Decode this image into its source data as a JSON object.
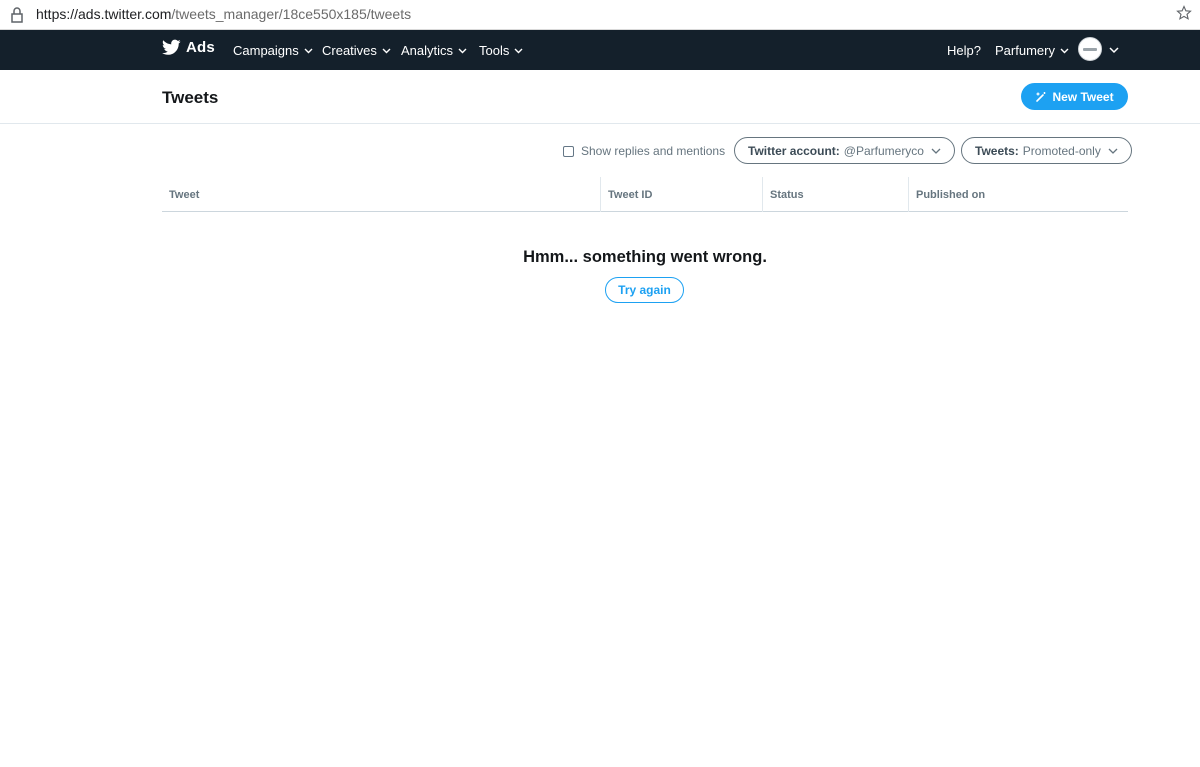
{
  "browser": {
    "url_host": "https://ads.twitter.com",
    "url_path": "/tweets_manager/18ce550x185/tweets"
  },
  "nav": {
    "brand": "Ads",
    "items": [
      {
        "label": "Campaigns"
      },
      {
        "label": "Creatives"
      },
      {
        "label": "Analytics"
      },
      {
        "label": "Tools"
      }
    ],
    "help": "Help?",
    "account": "Parfumery"
  },
  "page": {
    "title": "Tweets",
    "new_tweet": "New Tweet"
  },
  "filters": {
    "show_replies": "Show replies and mentions",
    "account_label": "Twitter account:",
    "account_value": "@Parfumeryco",
    "tweets_label": "Tweets:",
    "tweets_value": "Promoted-only"
  },
  "table": {
    "columns": [
      "Tweet",
      "Tweet ID",
      "Status",
      "Published on"
    ]
  },
  "error": {
    "message": "Hmm... something went wrong.",
    "retry": "Try again"
  },
  "colors": {
    "nav_bg": "#14202b",
    "accent": "#1da1f2"
  }
}
